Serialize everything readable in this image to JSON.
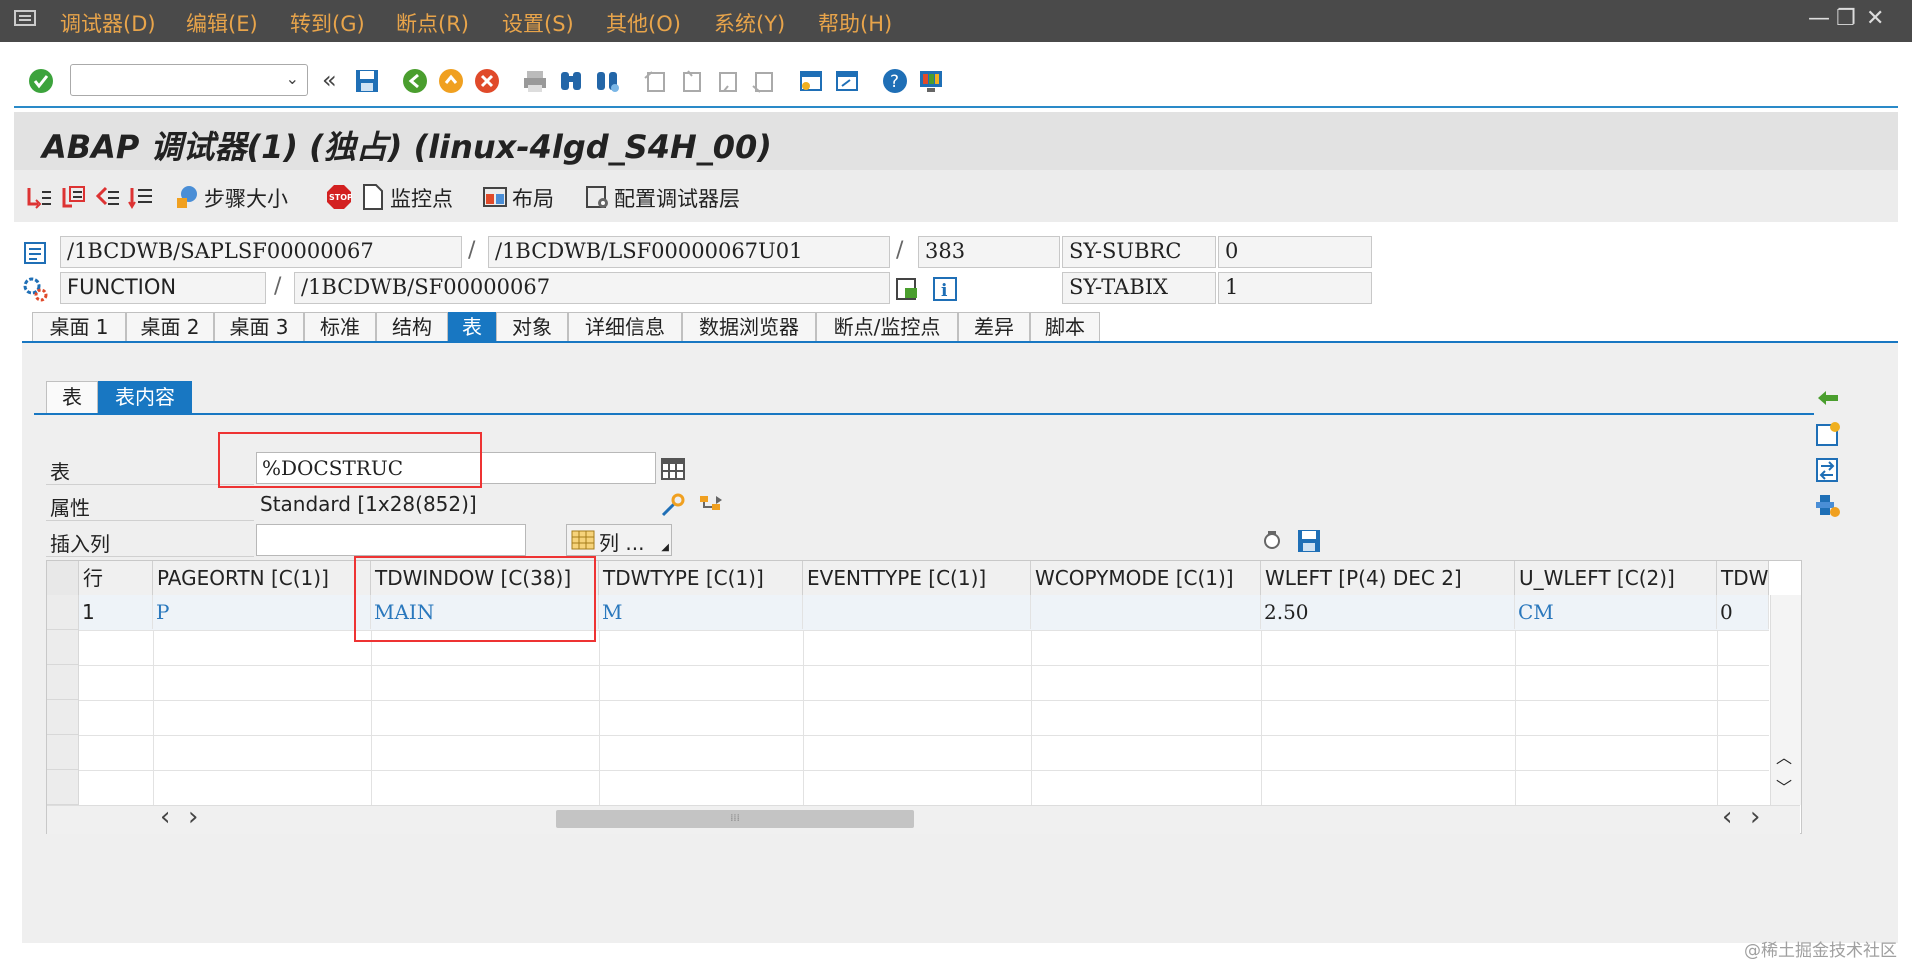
{
  "menu": [
    "调试器(D)",
    "编辑(E)",
    "转到(G)",
    "断点(R)",
    "设置(S)",
    "其他(O)",
    "系统(Y)",
    "帮助(H)"
  ],
  "window_controls": [
    "—",
    "❐",
    "✕"
  ],
  "toolbar": {
    "back_label": "«"
  },
  "title": "ABAP 调试器(1) (独占) (linux-4lgd_S4H_00)",
  "app_toolbar": {
    "step_size": "步骤大小",
    "watchpoint": "监控点",
    "layout": "布局",
    "configure_layers": "配置调试器层"
  },
  "status": {
    "program": "/1BCDWB/SAPLSF00000067",
    "include": "/1BCDWB/LSF00000067U01",
    "line": "383",
    "subrc_label": "SY-SUBRC",
    "subrc_value": "0",
    "event_type": "FUNCTION",
    "event": "/1BCDWB/SF00000067",
    "tabix_label": "SY-TABIX",
    "tabix_value": "1",
    "separator": "/"
  },
  "tabs": [
    "桌面 1",
    "桌面 2",
    "桌面 3",
    "标准",
    "结构",
    "表",
    "对象",
    "详细信息",
    "数据浏览器",
    "断点/监控点",
    "差异",
    "脚本"
  ],
  "active_tab": "表",
  "subtabs": [
    "表",
    "表内容"
  ],
  "active_subtab": "表内容",
  "form": {
    "table_label": "表",
    "table_value": "%DOCSTRUC",
    "attributes_label": "属性",
    "attributes_value": "Standard [1x28(852)]",
    "insert_col_label": "插入列",
    "insert_col_value": "",
    "columns_button": "列 ..."
  },
  "grid": {
    "columns": [
      "行",
      "PAGEORTN [C(1)]",
      "TDWINDOW [C(38)]",
      "TDWTYPE [C(1)]",
      "EVENTTYPE [C(1)]",
      "WCOPYMODE [C(1)]",
      "WLEFT [P(4) DEC 2]",
      "U_WLEFT [C(2)]",
      "TDWI"
    ],
    "rows": [
      [
        "1",
        "P",
        "MAIN",
        "M",
        "",
        "",
        "2.50",
        "CM",
        "0"
      ]
    ],
    "scroll_left": "‹",
    "scroll_right": "›",
    "scroll_up": "︿",
    "scroll_down": "﹀"
  },
  "watermark": "@稀土掘金技术社区"
}
